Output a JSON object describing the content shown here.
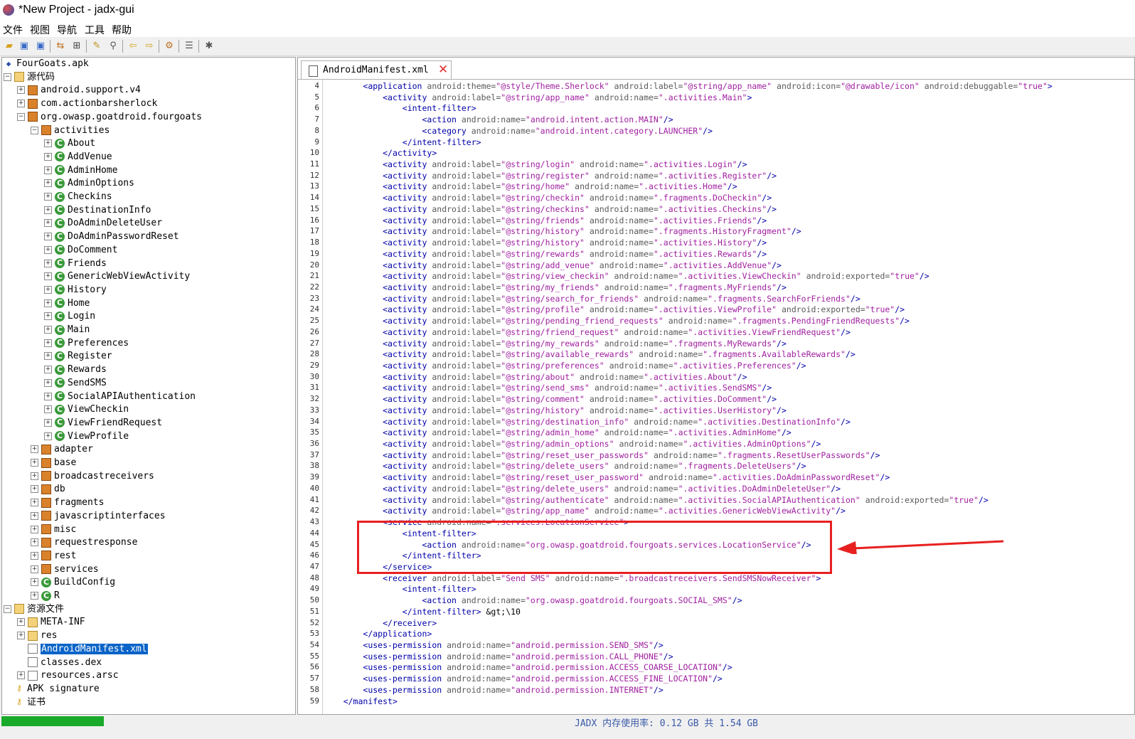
{
  "window": {
    "title": "*New Project - jadx-gui"
  },
  "menu": [
    "文件",
    "视图",
    "导航",
    "工具",
    "帮助"
  ],
  "toolbar": {
    "icons": [
      "open-folder-icon",
      "save-icon",
      "save-all-icon",
      "sync-icon",
      "flatten-icon",
      "wand-icon",
      "search-icon",
      "back-icon",
      "forward-icon",
      "decompile-icon",
      "log-icon",
      "settings-icon"
    ]
  },
  "tree": {
    "root": "FourGoats.apk",
    "source_code": "源代码",
    "packages": [
      "android.support.v4",
      "com.actionbarsherlock",
      "org.owasp.goatdroid.fourgoats"
    ],
    "activities_pkg": "activities",
    "activities": [
      "About",
      "AddVenue",
      "AdminHome",
      "AdminOptions",
      "Checkins",
      "DestinationInfo",
      "DoAdminDeleteUser",
      "DoAdminPasswordReset",
      "DoComment",
      "Friends",
      "GenericWebViewActivity",
      "History",
      "Home",
      "Login",
      "Main",
      "Preferences",
      "Register",
      "Rewards",
      "SendSMS",
      "SocialAPIAuthentication",
      "ViewCheckin",
      "ViewFriendRequest",
      "ViewProfile"
    ],
    "subpackages": [
      "adapter",
      "base",
      "broadcastreceivers",
      "db",
      "fragments",
      "javascriptinterfaces",
      "misc",
      "requestresponse",
      "rest",
      "services"
    ],
    "classes": [
      "BuildConfig",
      "R"
    ],
    "resources": "资源文件",
    "res_items": [
      "META-INF",
      "res",
      "AndroidManifest.xml",
      "classes.dex",
      "resources.arsc"
    ],
    "apk_signature": "APK signature",
    "certificate": "证书"
  },
  "editor": {
    "tab_label": "AndroidManifest.xml",
    "first_line": 4,
    "lines": [
      "        <application android:theme=\"@style/Theme.Sherlock\" android:label=\"@string/app_name\" android:icon=\"@drawable/icon\" android:debuggable=\"true\">",
      "            <activity android:label=\"@string/app_name\" android:name=\".activities.Main\">",
      "                <intent-filter>",
      "                    <action android:name=\"android.intent.action.MAIN\"/>",
      "                    <category android:name=\"android.intent.category.LAUNCHER\"/>",
      "                </intent-filter>",
      "            </activity>",
      "            <activity android:label=\"@string/login\" android:name=\".activities.Login\"/>",
      "            <activity android:label=\"@string/register\" android:name=\".activities.Register\"/>",
      "            <activity android:label=\"@string/home\" android:name=\".activities.Home\"/>",
      "            <activity android:label=\"@string/checkin\" android:name=\".fragments.DoCheckin\"/>",
      "            <activity android:label=\"@string/checkins\" android:name=\".activities.Checkins\"/>",
      "            <activity android:label=\"@string/friends\" android:name=\".activities.Friends\"/>",
      "            <activity android:label=\"@string/history\" android:name=\".fragments.HistoryFragment\"/>",
      "            <activity android:label=\"@string/history\" android:name=\".activities.History\"/>",
      "            <activity android:label=\"@string/rewards\" android:name=\".activities.Rewards\"/>",
      "            <activity android:label=\"@string/add_venue\" android:name=\".activities.AddVenue\"/>",
      "            <activity android:label=\"@string/view_checkin\" android:name=\".activities.ViewCheckin\" android:exported=\"true\"/>",
      "            <activity android:label=\"@string/my_friends\" android:name=\".fragments.MyFriends\"/>",
      "            <activity android:label=\"@string/search_for_friends\" android:name=\".fragments.SearchForFriends\"/>",
      "            <activity android:label=\"@string/profile\" android:name=\".activities.ViewProfile\" android:exported=\"true\"/>",
      "            <activity android:label=\"@string/pending_friend_requests\" android:name=\".fragments.PendingFriendRequests\"/>",
      "            <activity android:label=\"@string/friend_request\" android:name=\".activities.ViewFriendRequest\"/>",
      "            <activity android:label=\"@string/my_rewards\" android:name=\".fragments.MyRewards\"/>",
      "            <activity android:label=\"@string/available_rewards\" android:name=\".fragments.AvailableRewards\"/>",
      "            <activity android:label=\"@string/preferences\" android:name=\".activities.Preferences\"/>",
      "            <activity android:label=\"@string/about\" android:name=\".activities.About\"/>",
      "            <activity android:label=\"@string/send_sms\" android:name=\".activities.SendSMS\"/>",
      "            <activity android:label=\"@string/comment\" android:name=\".activities.DoComment\"/>",
      "            <activity android:label=\"@string/history\" android:name=\".activities.UserHistory\"/>",
      "            <activity android:label=\"@string/destination_info\" android:name=\".activities.DestinationInfo\"/>",
      "            <activity android:label=\"@string/admin_home\" android:name=\".activities.AdminHome\"/>",
      "            <activity android:label=\"@string/admin_options\" android:name=\".activities.AdminOptions\"/>",
      "            <activity android:label=\"@string/reset_user_passwords\" android:name=\".fragments.ResetUserPasswords\"/>",
      "            <activity android:label=\"@string/delete_users\" android:name=\".fragments.DeleteUsers\"/>",
      "            <activity android:label=\"@string/reset_user_password\" android:name=\".activities.DoAdminPasswordReset\"/>",
      "            <activity android:label=\"@string/delete_users\" android:name=\".activities.DoAdminDeleteUser\"/>",
      "            <activity android:label=\"@string/authenticate\" android:name=\".activities.SocialAPIAuthentication\" android:exported=\"true\"/>",
      "            <activity android:label=\"@string/app_name\" android:name=\".activities.GenericWebViewActivity\"/>",
      "            <service android:name=\".services.LocationService\">",
      "                <intent-filter>",
      "                    <action android:name=\"org.owasp.goatdroid.fourgoats.services.LocationService\"/>",
      "                </intent-filter>",
      "            </service>",
      "            <receiver android:label=\"Send SMS\" android:name=\".broadcastreceivers.SendSMSNowReceiver\">",
      "                <intent-filter>",
      "                    <action android:name=\"org.owasp.goatdroid.fourgoats.SOCIAL_SMS\"/>",
      "                </intent-filter> &gt;\\10",
      "            </receiver>",
      "        </application>",
      "        <uses-permission android:name=\"android.permission.SEND_SMS\"/>",
      "        <uses-permission android:name=\"android.permission.CALL_PHONE\"/>",
      "        <uses-permission android:name=\"android.permission.ACCESS_COARSE_LOCATION\"/>",
      "        <uses-permission android:name=\"android.permission.ACCESS_FINE_LOCATION\"/>",
      "        <uses-permission android:name=\"android.permission.INTERNET\"/>",
      "    </manifest>"
    ]
  },
  "status": {
    "memory": "JADX 内存使用率: 0.12 GB 共 1.54 GB",
    "progress": 0.09
  },
  "colors": {
    "tag": "#0000a8",
    "attr": "#5a5a5a",
    "value": "#a020a0",
    "highlight": "#e82020",
    "selection": "#0a64c8",
    "progress": "#1aaa2a"
  }
}
